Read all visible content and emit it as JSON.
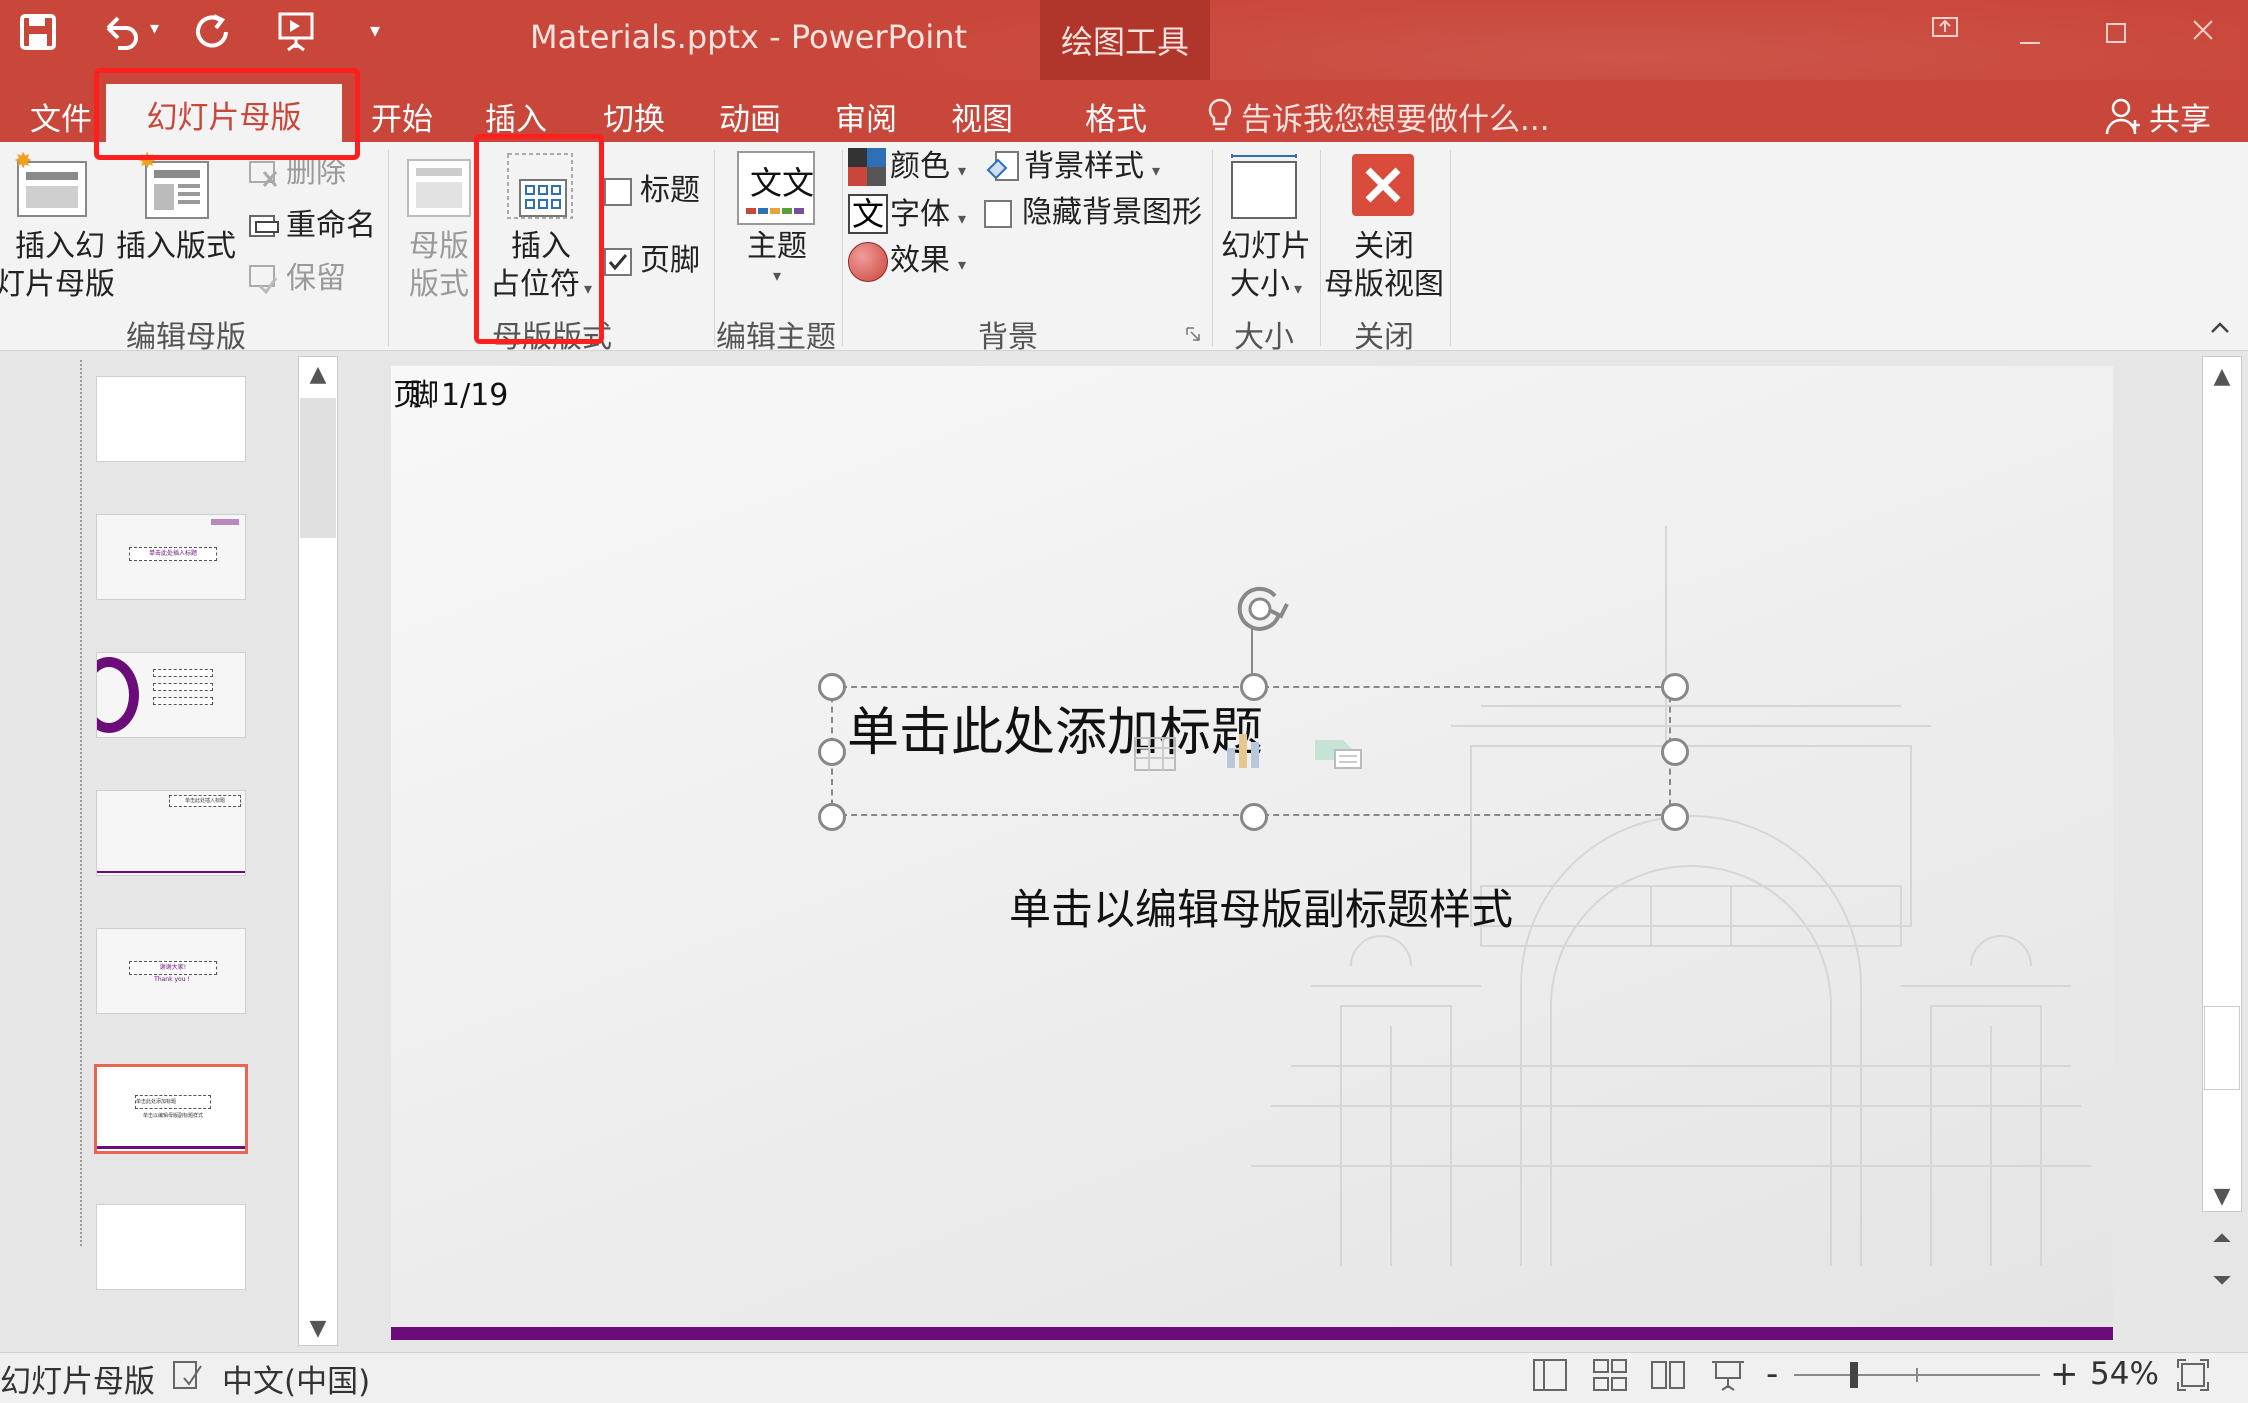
{
  "window": {
    "doc_title": "Materials.pptx - PowerPoint",
    "context_tab": "绘图工具",
    "title_bar_color": "#c9463a"
  },
  "tabs": [
    {
      "label": "文件"
    },
    {
      "label": "幻灯片母版",
      "active": true
    },
    {
      "label": "开始"
    },
    {
      "label": "插入"
    },
    {
      "label": "切换"
    },
    {
      "label": "动画"
    },
    {
      "label": "审阅"
    },
    {
      "label": "视图"
    },
    {
      "label": "格式"
    }
  ],
  "tell_me": "告诉我您想要做什么...",
  "share": "共享",
  "ribbon": {
    "edit_master": {
      "insert_master_line1": "插入幻",
      "insert_master_line2": "灯片母版",
      "insert_layout": "插入版式",
      "delete": "删除",
      "rename": "重命名",
      "preserve": "保留",
      "group_label": "编辑母版"
    },
    "master_layout": {
      "master_layout_line1": "母版",
      "master_layout_line2": "版式",
      "insert_placeholder_line1": "插入",
      "insert_placeholder_line2": "占位符",
      "title_checkbox": "标题",
      "title_checked": false,
      "footer_checkbox": "页脚",
      "footer_checked": true,
      "group_label": "母版版式"
    },
    "edit_theme": {
      "themes": "主题",
      "theme_glyph": "文文",
      "group_label": "编辑主题"
    },
    "background": {
      "colors": "颜色",
      "fonts": "字体",
      "font_glyph": "文",
      "effects": "效果",
      "background_styles": "背景样式",
      "hide_background": "隐藏背景图形",
      "group_label": "背景"
    },
    "size": {
      "slide_size_line1": "幻灯片",
      "slide_size_line2": "大小",
      "group_label": "大小"
    },
    "close": {
      "close_line1": "关闭",
      "close_line2": "母版视图",
      "group_label": "关闭"
    }
  },
  "thumbnails": [
    {
      "title": "",
      "subtitle": ""
    },
    {
      "title": "单击此处插入标题",
      "subtitle": ""
    },
    {
      "title": "",
      "subtitle": "",
      "kind": "toc"
    },
    {
      "title": "单击此处插入标题",
      "subtitle": ""
    },
    {
      "title": "谢谢大家!",
      "subtitle": "Thank you !"
    },
    {
      "title": "单击此处添加标题",
      "subtitle": "单击以编辑母版副标题样式",
      "selected": true
    },
    {
      "title": "",
      "subtitle": ""
    }
  ],
  "slide": {
    "date_footer": "页脚",
    "date_overlap": "1/19",
    "title_placeholder": "单击此处添加标题",
    "subtitle_placeholder": "单击以编辑母版副标题样式",
    "band_color": "#6b0c7a"
  },
  "status": {
    "view_name": "幻灯片母版",
    "language": "中文(中国)",
    "zoom": "54%",
    "minus": "-",
    "plus": "+"
  },
  "icons": [
    "save-icon",
    "undo-icon",
    "redo-icon",
    "presentation-icon",
    "customize-qat-icon",
    "lightbulb-icon",
    "person-add-icon",
    "restore-icon",
    "minimize-icon",
    "maximize-icon",
    "close-window-icon"
  ]
}
